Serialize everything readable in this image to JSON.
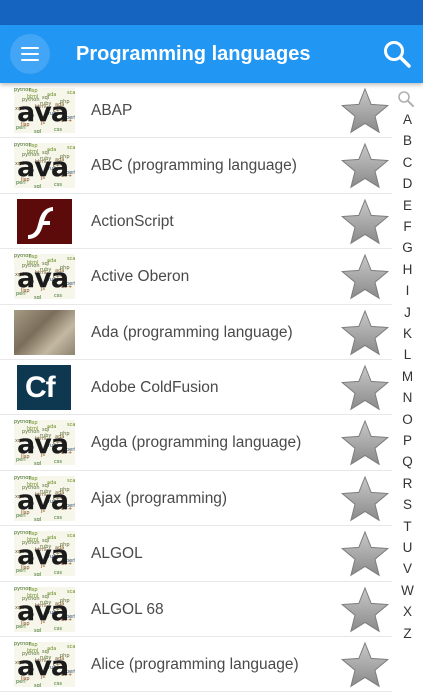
{
  "app_bar": {
    "title": "Programming languages",
    "menu_icon": "hamburger-menu-icon",
    "search_icon": "search-icon"
  },
  "colors": {
    "status_bar": "#1565c0",
    "app_bar": "#2196f3",
    "menu_button": "#42a5f5",
    "star": "#9e9e9e"
  },
  "items": [
    {
      "label": "ABAP",
      "thumb": "java"
    },
    {
      "label": "ABC (programming language)",
      "thumb": "java"
    },
    {
      "label": "ActionScript",
      "thumb": "flash"
    },
    {
      "label": "Active Oberon",
      "thumb": "java"
    },
    {
      "label": "Ada (programming language)",
      "thumb": "photo"
    },
    {
      "label": "Adobe ColdFusion",
      "thumb": "coldfusion",
      "thumb_text": "Cf"
    },
    {
      "label": "Agda (programming language)",
      "thumb": "java"
    },
    {
      "label": "Ajax (programming)",
      "thumb": "java"
    },
    {
      "label": "ALGOL",
      "thumb": "java"
    },
    {
      "label": "ALGOL 68",
      "thumb": "java"
    },
    {
      "label": "Alice (programming language)",
      "thumb": "java"
    }
  ],
  "index": {
    "search_icon": "index-search-icon",
    "letters": [
      "A",
      "B",
      "C",
      "D",
      "E",
      "F",
      "G",
      "H",
      "I",
      "J",
      "K",
      "L",
      "M",
      "N",
      "O",
      "P",
      "Q",
      "R",
      "S",
      "T",
      "U",
      "V",
      "W",
      "X",
      "Z"
    ]
  }
}
